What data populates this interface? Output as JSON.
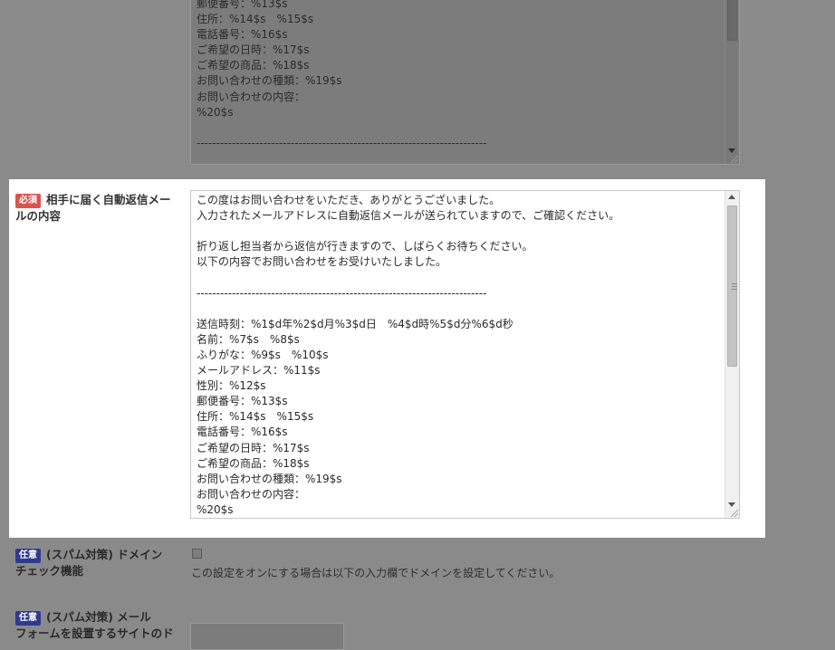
{
  "prev_textarea": {
    "lines": [
      "郵便番号：%13$s",
      "住所：%14$s　%15$s",
      "電話番号：%16$s",
      "ご希望の日時：%17$s",
      "ご希望の商品：%18$s",
      "お問い合わせの種類：%19$s",
      "お問い合わせの内容：",
      "%20$s",
      "",
      "--------------------------------------------------------------------------"
    ]
  },
  "auto_reply": {
    "badge": "必須",
    "label_line1": "相手に届く自動返信メー",
    "label_line2": "ルの内容",
    "lines": [
      "この度はお問い合わせをいただき、ありがとうございました。",
      "入力されたメールアドレスに自動返信メールが送られていますので、ご確認ください。",
      "",
      "折り返し担当者から返信が行きますので、しばらくお待ちください。",
      "以下の内容でお問い合わせをお受けいたしました。",
      "",
      "--------------------------------------------------------------------------",
      "",
      "送信時刻：%1$d年%2$d月%3$d日　%4$d時%5$d分%6$d秒",
      "名前：%7$s　%8$s",
      "ふりがな：%9$s　%10$s",
      "メールアドレス：%11$s",
      "性別：%12$s",
      "郵便番号：%13$s",
      "住所：%14$s　%15$s",
      "電話番号：%16$s",
      "ご希望の日時：%17$s",
      "ご希望の商品：%18$s",
      "お問い合わせの種類：%19$s",
      "お問い合わせの内容：",
      "%20$s"
    ]
  },
  "domain_check": {
    "badge": "任意",
    "label_line1": "(スパム対策) ドメイン",
    "label_line2": "チェック機能",
    "help": "この設定をオンにする場合は以下の入力欄でドメインを設定してください。"
  },
  "mail_site": {
    "badge": "任意",
    "label_line1": "(スパム対策) メール",
    "label_line2": "フォームを設置するサイトのド"
  }
}
